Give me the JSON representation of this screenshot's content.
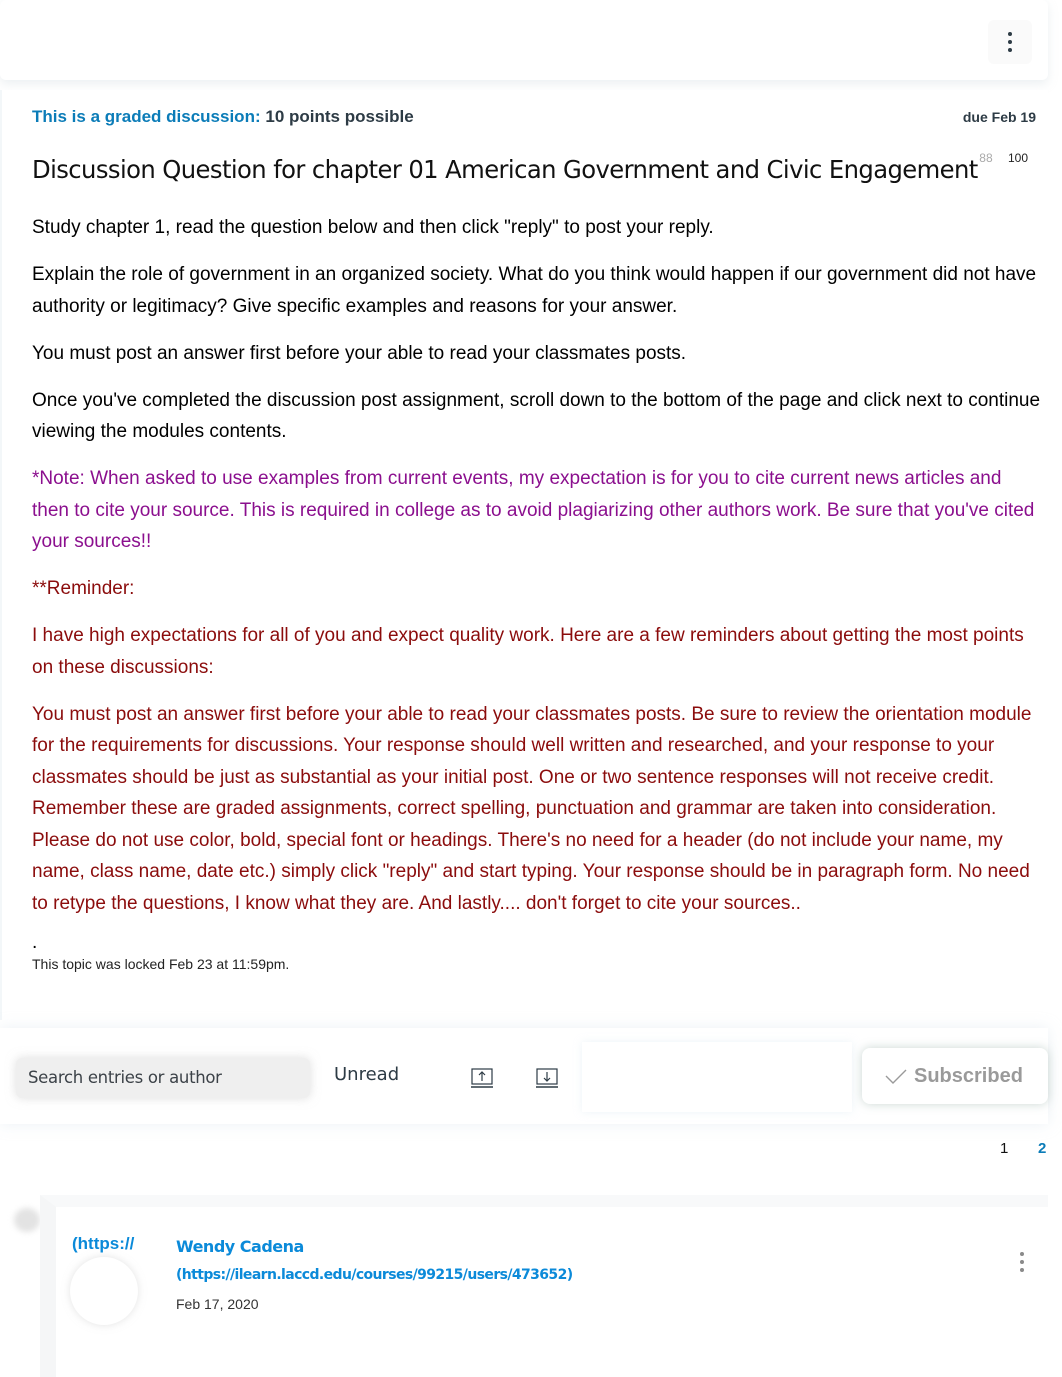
{
  "header": {
    "more_options_icon": "kebab-vertical-icon"
  },
  "discussion": {
    "graded_label": "This is a graded discussion:",
    "points": "10 points possible",
    "due": "due Feb 19",
    "grade_values": [
      "88",
      "100"
    ],
    "title": "Discussion Question for chapter 01 American Government and Civic Engagement",
    "paragraphs": [
      "Study chapter 1, read the question below and then click \"reply\" to post your reply.",
      "Explain the role of government in an organized society. What do you think would happen if our government did not have authority or legitimacy?  Give specific examples and reasons for your answer.",
      "You must post an answer first before your able to read your classmates posts.",
      "Once you've completed the discussion post assignment, scroll down to the bottom of the page and click next to continue viewing the modules contents."
    ],
    "note": "*Note: When asked to use examples from current events, my expectation is for you to cite current news articles and then to cite your source. This is required in college as to avoid plagiarizing other authors work. Be sure that you've cited your sources!!",
    "reminder_heading": "**Reminder:",
    "reminder_intro": "I have high expectations for all of you and expect quality work.  Here are a few reminders about getting the most points on these discussions:",
    "reminder_body": "You must post an answer first before your able to read your classmates posts.  Be sure to review the orientation module for the requirements for discussions.  Your response should well written and researched, and your response to your classmates should be just as substantial as your initial post.  One or two sentence responses will not receive credit.  Remember these are graded assignments, correct spelling, punctuation and grammar are taken into consideration.  Please do not use color, bold, special font or headings. There's no need for a header (do not include your name, my name, class name, date etc.) simply click \"reply\" and start typing. Your response should be in paragraph form.  No need to retype the questions, I know what they are.  And lastly.... don't forget to cite your sources..",
    "trailing_dot": ".",
    "locked_text": "This topic was locked Feb 23 at 11:59pm.",
    "colors": {
      "graded_label": "#0b7cb8",
      "note": "#8b0f8e",
      "reminder": "#8b0c0c"
    }
  },
  "toolbar": {
    "search_placeholder": "Search entries or author",
    "filter_label": "Unread",
    "expand_icon": "arrow-up-box-icon",
    "collapse_icon": "arrow-down-box-icon",
    "subscribe_label": "Subscribed",
    "subscribe_icon": "checkmark-icon"
  },
  "pagination": {
    "pages": [
      "1",
      "2"
    ],
    "current": "2"
  },
  "entries": [
    {
      "avatar_text": "(https://",
      "author": "Wendy Cadena",
      "author_url": "(https://ilearn.laccd.edu/courses/99215/users/473652)",
      "date": "Feb 17, 2020"
    }
  ]
}
